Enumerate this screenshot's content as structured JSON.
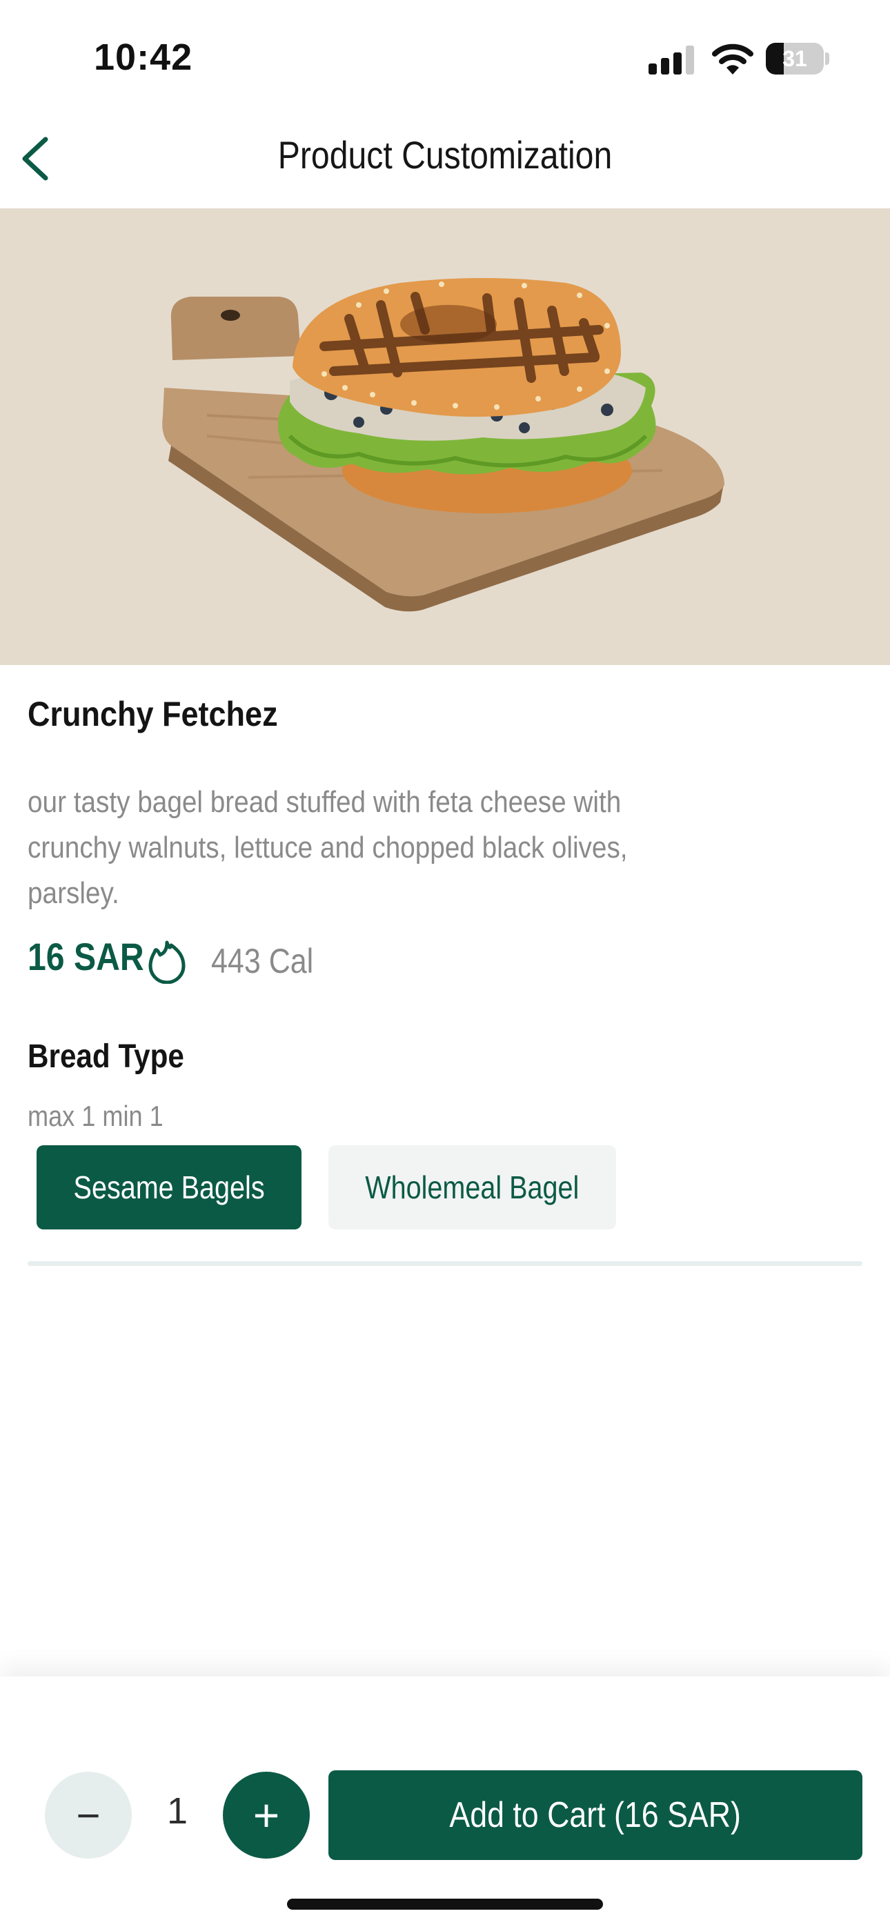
{
  "status_bar": {
    "time": "10:42",
    "battery_level": "31",
    "icons": [
      "cellular-signal-icon",
      "wifi-icon",
      "battery-icon"
    ]
  },
  "nav": {
    "title": "Product Customization",
    "back_icon": "chevron-left-icon"
  },
  "product": {
    "image_alt": "bagel-sandwich-image",
    "name": "Crunchy Fetchez",
    "description": "our tasty bagel bread stuffed with feta cheese with crunchy walnuts, lettuce and chopped black olives, parsley.",
    "price": "16 SAR",
    "calories": "443 Cal",
    "calorie_icon": "flame-icon"
  },
  "bread_type": {
    "title": "Bread Type",
    "constraint": "max 1 min 1",
    "options": [
      {
        "label": "Sesame Bagels",
        "selected": true
      },
      {
        "label": "Wholemeal Bagel",
        "selected": false
      }
    ]
  },
  "cart": {
    "quantity": "1",
    "minus_label": "−",
    "plus_label": "+",
    "add_label": "Add to Cart (16 SAR)"
  },
  "colors": {
    "brand": "#0b5a45",
    "hero_bg": "#e4dbcd",
    "muted_text": "#8a8a8a",
    "option_bg": "#f2f3f3"
  }
}
